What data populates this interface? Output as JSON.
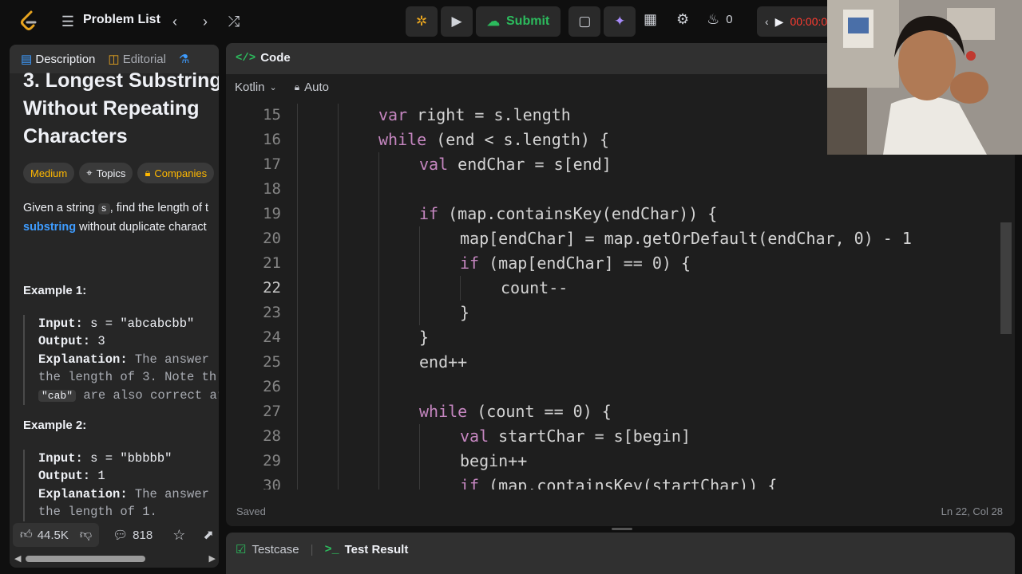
{
  "topbar": {
    "problem_list_label": "Problem List",
    "submit_label": "Submit",
    "streak_count": "0",
    "timer_text": "00:00:0"
  },
  "left_panel": {
    "tabs": {
      "description": "Description",
      "editorial": "Editorial"
    },
    "title": "3. Longest Substring\nWithout Repeating\nCharacters",
    "tags": {
      "difficulty": "Medium",
      "topics": "Topics",
      "companies": "Companies"
    },
    "description": {
      "part1": "Given a string ",
      "code": "s",
      "part2": ", find the length of t",
      "link": "substring",
      "part3": " without duplicate charact"
    },
    "examples": [
      {
        "title": "Example 1:",
        "input_label": "Input:",
        "input_value": " s = \"abcabcbb\"",
        "output_label": "Output:",
        "output_value": " 3",
        "explanation_label": "Explanation:",
        "explanation_line1": " The answer",
        "explanation_line2": "the length of 3. Note th",
        "explanation_code": "\"cab\"",
        "explanation_line3": " are also correct ar"
      },
      {
        "title": "Example 2:",
        "input_label": "Input:",
        "input_value": " s = \"bbbbb\"",
        "output_label": "Output:",
        "output_value": " 1",
        "explanation_label": "Explanation:",
        "explanation_line1": " The answer",
        "explanation_line2": "the length of 1."
      }
    ],
    "footer": {
      "likes": "44.5K",
      "comments": "818"
    }
  },
  "code_panel": {
    "title": "Code",
    "language": "Kotlin",
    "mode": "Auto",
    "lines": [
      {
        "num": "15",
        "indent": 2,
        "kw": "var",
        "rest": " right = s.length"
      },
      {
        "num": "16",
        "indent": 2,
        "kw": "while",
        "rest": " (end < s.length) {"
      },
      {
        "num": "17",
        "indent": 3,
        "kw": "val",
        "rest": " endChar = s[end]"
      },
      {
        "num": "18",
        "indent": 3,
        "kw": "",
        "rest": ""
      },
      {
        "num": "19",
        "indent": 3,
        "kw": "if",
        "rest": " (map.containsKey(endChar)) {"
      },
      {
        "num": "20",
        "indent": 4,
        "kw": "",
        "rest": "map[endChar] = map.getOrDefault(endChar, 0) - 1"
      },
      {
        "num": "21",
        "indent": 4,
        "kw": "if",
        "rest": " (map[endChar] == 0) {"
      },
      {
        "num": "22",
        "indent": 5,
        "kw": "",
        "rest": "count--"
      },
      {
        "num": "23",
        "indent": 4,
        "kw": "",
        "rest": "}"
      },
      {
        "num": "24",
        "indent": 3,
        "kw": "",
        "rest": "}"
      },
      {
        "num": "25",
        "indent": 3,
        "kw": "",
        "rest": "end++"
      },
      {
        "num": "26",
        "indent": 3,
        "kw": "",
        "rest": ""
      },
      {
        "num": "27",
        "indent": 3,
        "kw": "while",
        "rest": " (count == 0) {"
      },
      {
        "num": "28",
        "indent": 4,
        "kw": "val",
        "rest": " startChar = s[begin]"
      },
      {
        "num": "29",
        "indent": 4,
        "kw": "",
        "rest": "begin++"
      },
      {
        "num": "30",
        "indent": 4,
        "kw": "if",
        "rest": " (map.containsKey(startChar)) {"
      }
    ],
    "active_line": "22",
    "status_saved": "Saved",
    "cursor_position": "Ln 22, Col 28"
  },
  "bottom_panel": {
    "tabs": {
      "testcase": "Testcase",
      "test_result": "Test Result"
    }
  },
  "colors": {
    "accent_green": "#2cbb5d",
    "difficulty_medium": "#ffb800",
    "keyword": "#c586c0",
    "link": "#3e9cff",
    "timer_red": "#ff3b30"
  }
}
